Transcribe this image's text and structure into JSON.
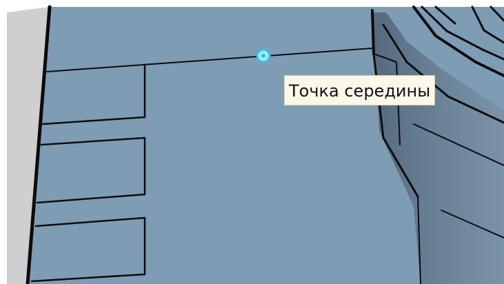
{
  "viewport": {
    "snap_tooltip": "Точка середины",
    "snap_marker_icon": "midpoint-snap-icon",
    "colors": {
      "floor_face": "#7f9cb5",
      "wall_side_face": "#62798f",
      "edge": "#0c0c0c",
      "left_frame": "#cfcfcf",
      "snap_marker": "#31c4e0",
      "tooltip_bg": "#fbf8ea"
    }
  }
}
